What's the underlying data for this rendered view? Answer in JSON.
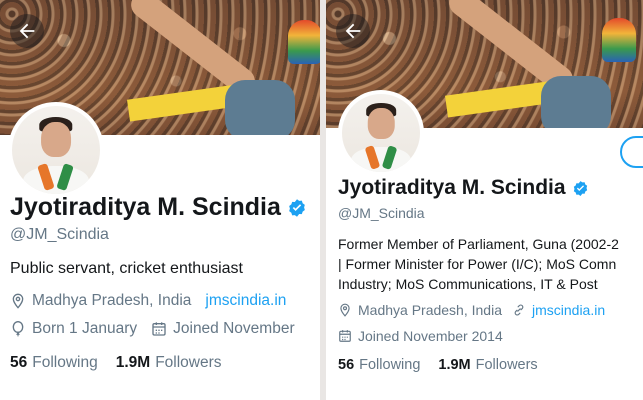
{
  "left": {
    "name": "Jyotiraditya M. Scindia",
    "handle": "@JM_Scindia",
    "bio": "Public servant, cricket enthusiast",
    "location": "Madhya Pradesh, India",
    "website": "jmscindia.in",
    "birthday": "Born 1 January",
    "joined": "Joined November",
    "following_count": "56",
    "following_label": "Following",
    "followers_count": "1.9M",
    "followers_label": "Followers"
  },
  "right": {
    "name": "Jyotiraditya M. Scindia",
    "handle": "@JM_Scindia",
    "bio_lines": [
      "Former Member of Parliament, Guna (2002-2",
      "| Former Minister for Power (I/C); MoS Comn",
      "Industry; MoS Communications, IT & Post"
    ],
    "location": "Madhya Pradesh, India",
    "website": "jmscindia.in",
    "joined": "Joined November 2014",
    "following_count": "56",
    "following_label": "Following",
    "followers_count": "1.9M",
    "followers_label": "Followers"
  },
  "icons": {
    "back": "arrow-left-icon",
    "verified": "verified-badge-icon",
    "location": "location-pin-icon",
    "link": "link-icon",
    "birthday": "balloon-icon",
    "calendar": "calendar-icon"
  },
  "colors": {
    "accent": "#1da1f2",
    "text_primary": "#14171a",
    "text_secondary": "#657786"
  }
}
